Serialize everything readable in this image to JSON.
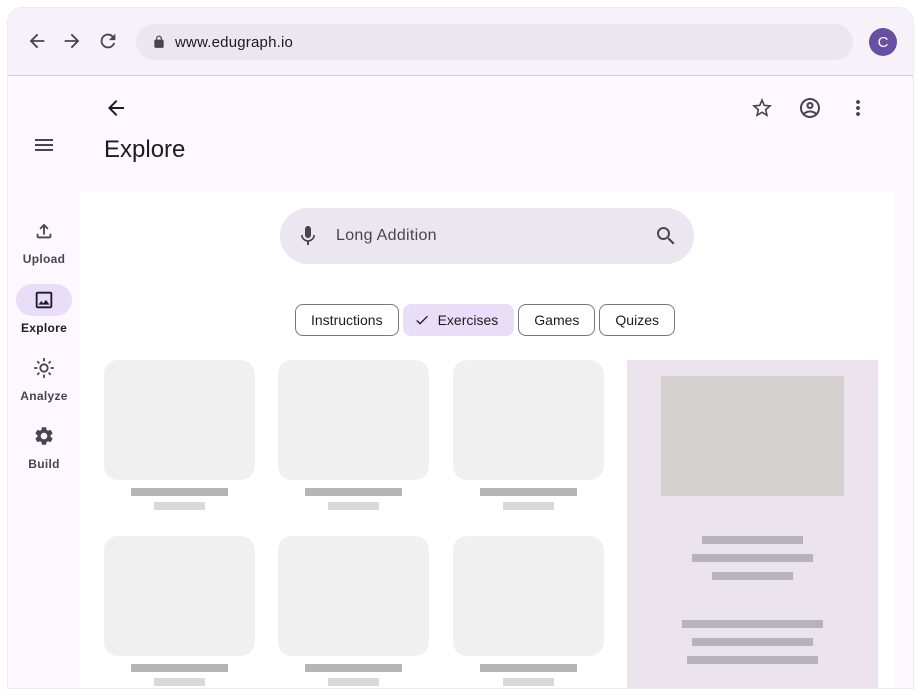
{
  "browser": {
    "url": "www.edugraph.io",
    "avatar_letter": "C",
    "icons": [
      "back-icon",
      "forward-icon",
      "reload-icon",
      "lock-icon"
    ]
  },
  "rail": {
    "items": [
      {
        "label": "Upload",
        "icon": "upload-icon",
        "active": false
      },
      {
        "label": "Explore",
        "icon": "image-icon",
        "active": true
      },
      {
        "label": "Analyze",
        "icon": "brightness-icon",
        "active": false
      },
      {
        "label": "Build",
        "icon": "gear-icon",
        "active": false
      }
    ]
  },
  "appbar": {
    "title": "Explore",
    "actions": [
      "star-icon",
      "account-circle-icon",
      "more-vert-icon"
    ]
  },
  "search": {
    "value": "Long Addition"
  },
  "chips": [
    {
      "label": "Instructions",
      "selected": false
    },
    {
      "label": "Exercises",
      "selected": true
    },
    {
      "label": "Games",
      "selected": false
    },
    {
      "label": "Quizes",
      "selected": false
    }
  ],
  "colors": {
    "accent": "#6750a4",
    "secondary_container": "#e8def8",
    "surface": "#fdf7ff",
    "search_bg": "#ece6f0",
    "side_panel": "#ebe4ef"
  }
}
